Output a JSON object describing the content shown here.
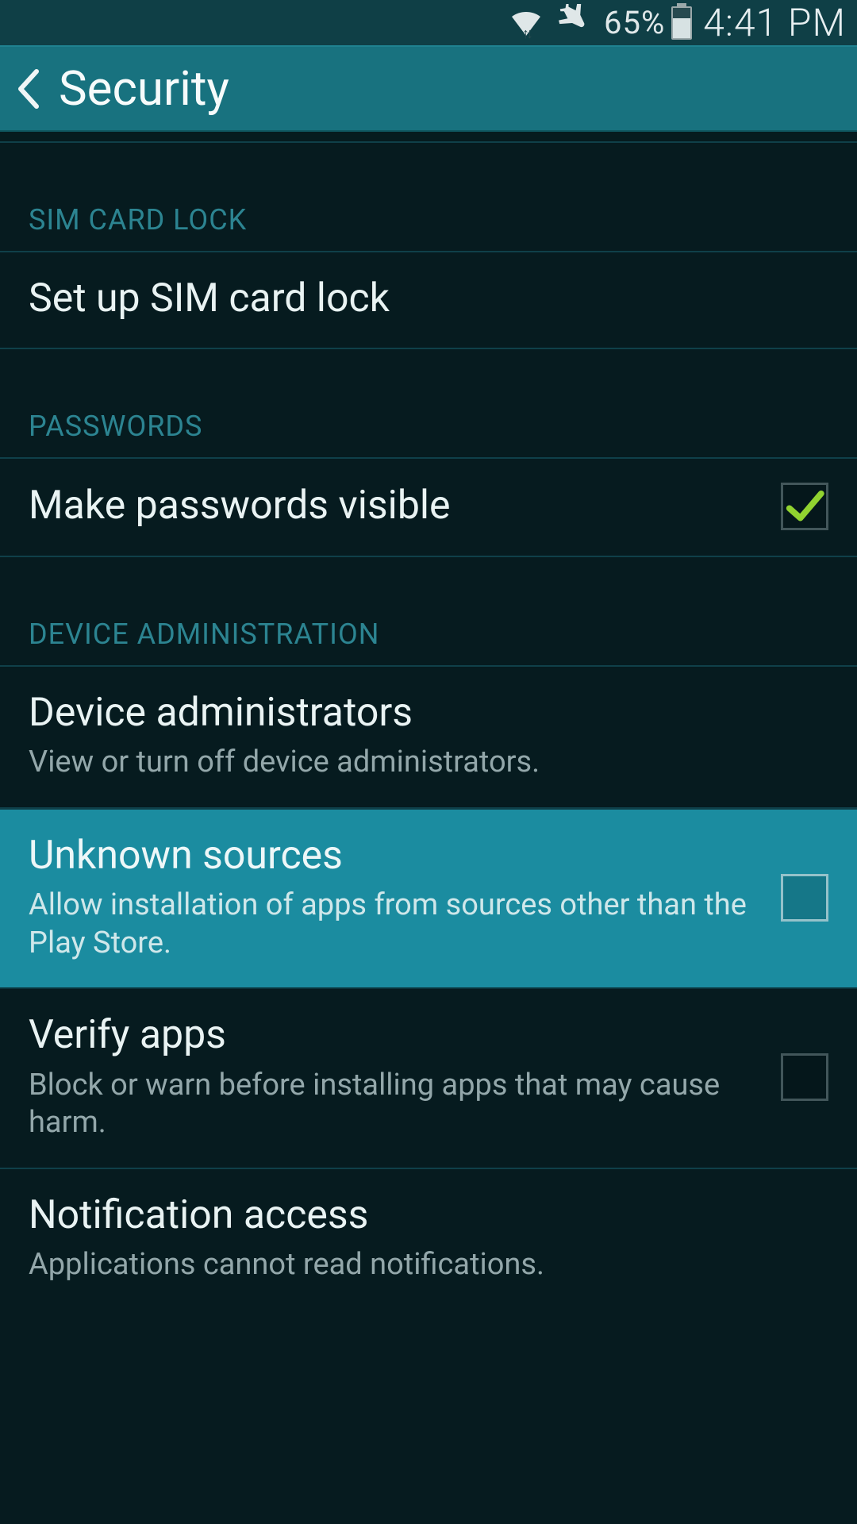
{
  "status_bar": {
    "battery_percent": "65%",
    "time": "4:41 PM"
  },
  "app_bar": {
    "title": "Security"
  },
  "sections": {
    "sim": {
      "header": "SIM CARD LOCK",
      "setup": {
        "title": "Set up SIM card lock"
      }
    },
    "passwords": {
      "header": "PASSWORDS",
      "visible": {
        "title": "Make passwords visible",
        "checked": true
      }
    },
    "device_admin": {
      "header": "DEVICE ADMINISTRATION",
      "administrators": {
        "title": "Device administrators",
        "subtitle": "View or turn off device administrators."
      },
      "unknown_sources": {
        "title": "Unknown sources",
        "subtitle": "Allow installation of apps from sources other than the Play Store.",
        "checked": false
      },
      "verify_apps": {
        "title": "Verify apps",
        "subtitle": "Block or warn before installing apps that may cause harm.",
        "checked": false
      },
      "notification_access": {
        "title": "Notification access",
        "subtitle": "Applications cannot read notifications."
      }
    }
  }
}
